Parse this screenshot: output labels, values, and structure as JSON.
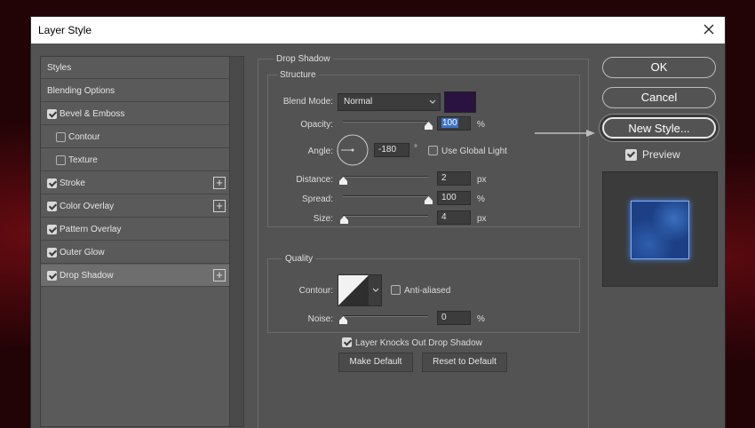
{
  "window": {
    "title": "Layer Style"
  },
  "styles_list": {
    "items": [
      {
        "label": "Styles",
        "checkbox": false,
        "checked": false,
        "plus": false,
        "indent": false,
        "selected": false
      },
      {
        "label": "Blending Options",
        "checkbox": false,
        "checked": false,
        "plus": false,
        "indent": false,
        "selected": false
      },
      {
        "label": "Bevel & Emboss",
        "checkbox": true,
        "checked": true,
        "plus": false,
        "indent": false,
        "selected": false
      },
      {
        "label": "Contour",
        "checkbox": true,
        "checked": false,
        "plus": false,
        "indent": true,
        "selected": false
      },
      {
        "label": "Texture",
        "checkbox": true,
        "checked": false,
        "plus": false,
        "indent": true,
        "selected": false
      },
      {
        "label": "Stroke",
        "checkbox": true,
        "checked": true,
        "plus": true,
        "indent": false,
        "selected": false
      },
      {
        "label": "Color Overlay",
        "checkbox": true,
        "checked": true,
        "plus": true,
        "indent": false,
        "selected": false
      },
      {
        "label": "Pattern Overlay",
        "checkbox": true,
        "checked": true,
        "plus": false,
        "indent": false,
        "selected": false
      },
      {
        "label": "Outer Glow",
        "checkbox": true,
        "checked": true,
        "plus": false,
        "indent": false,
        "selected": false
      },
      {
        "label": "Drop Shadow",
        "checkbox": true,
        "checked": true,
        "plus": true,
        "indent": false,
        "selected": true
      }
    ]
  },
  "drop_shadow": {
    "section_title": "Drop Shadow",
    "structure": {
      "title": "Structure",
      "blend_mode_label": "Blend Mode:",
      "blend_mode_value": "Normal",
      "shadow_color": "#2a1340",
      "opacity_label": "Opacity:",
      "opacity_value": "100",
      "opacity_fraction": 1.0,
      "opacity_unit": "%",
      "angle_label": "Angle:",
      "angle_value": "-180",
      "angle_unit": "°",
      "use_global_light_label": "Use Global Light",
      "use_global_light_checked": false,
      "distance_label": "Distance:",
      "distance_value": "2",
      "distance_fraction": 0.0,
      "distance_unit": "px",
      "spread_label": "Spread:",
      "spread_value": "100",
      "spread_fraction": 1.0,
      "spread_unit": "%",
      "size_label": "Size:",
      "size_value": "4",
      "size_fraction": 0.02,
      "size_unit": "px"
    },
    "quality": {
      "title": "Quality",
      "contour_label": "Contour:",
      "anti_aliased_label": "Anti-aliased",
      "anti_aliased_checked": false,
      "noise_label": "Noise:",
      "noise_value": "0",
      "noise_fraction": 0.0,
      "noise_unit": "%"
    },
    "knockout_label": "Layer Knocks Out Drop Shadow",
    "knockout_checked": true,
    "make_default_label": "Make Default",
    "reset_default_label": "Reset to Default"
  },
  "actions": {
    "ok_label": "OK",
    "cancel_label": "Cancel",
    "new_style_label": "New Style...",
    "preview_label": "Preview",
    "preview_checked": true
  },
  "colors": {
    "dialog_bg": "#535353",
    "preview_fill": "#1c3f85",
    "highlight": "#3d72c7"
  }
}
